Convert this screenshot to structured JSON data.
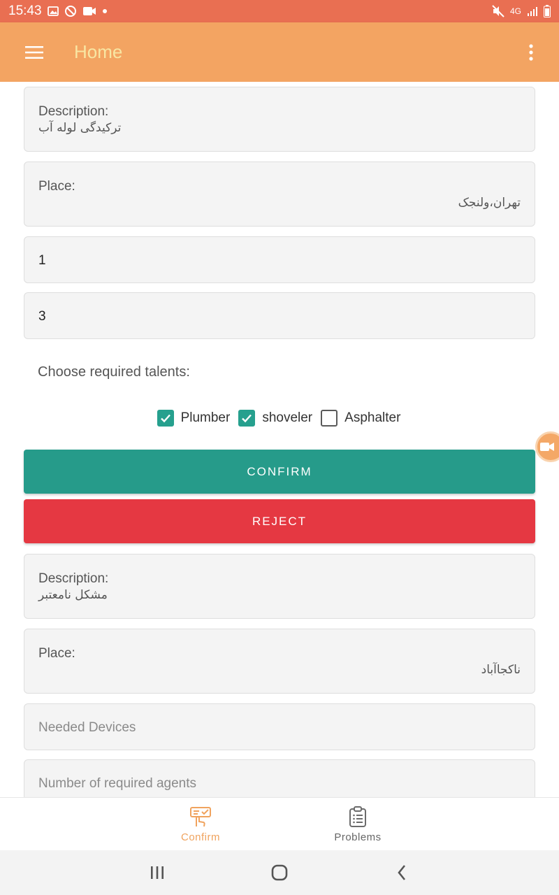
{
  "status_bar": {
    "time": "15:43",
    "network": "4G",
    "left_icons": [
      "image-icon",
      "blocked-icon",
      "video-icon",
      "dot-icon"
    ],
    "right_icons": [
      "mute-icon",
      "signal-icon",
      "battery-icon"
    ]
  },
  "app_bar": {
    "title": "Home",
    "menu_icon": "hamburger-icon",
    "overflow_icon": "more-vert-icon"
  },
  "item1": {
    "description_label": "Description:",
    "description_value": "ترکیدگی لوله آب",
    "place_label": "Place:",
    "place_value": "تهران،ولنجک",
    "field1_value": "1",
    "field2_value": "3",
    "talents_label": "Choose required talents:",
    "talents": [
      {
        "label": "Plumber",
        "checked": true
      },
      {
        "label": "shoveler",
        "checked": true
      },
      {
        "label": "Asphalter",
        "checked": false
      }
    ],
    "confirm_label": "CONFIRM",
    "reject_label": "REJECT"
  },
  "item2": {
    "description_label": "Description:",
    "description_value": "مشکل نامعتبر",
    "place_label": "Place:",
    "place_value": "ناکجاآباد",
    "devices_placeholder": "Needed Devices",
    "agents_placeholder": "Number of required agents"
  },
  "bottom_nav": {
    "items": [
      {
        "label": "Confirm",
        "icon": "confirm-icon",
        "active": true
      },
      {
        "label": "Problems",
        "icon": "clipboard-list-icon",
        "active": false
      }
    ]
  },
  "colors": {
    "status_bar": "#e96f52",
    "app_bar": "#f3a462",
    "title": "#f8e6a3",
    "confirm": "#269b8a",
    "reject": "#e53842",
    "nav_active": "#f0a35e"
  }
}
